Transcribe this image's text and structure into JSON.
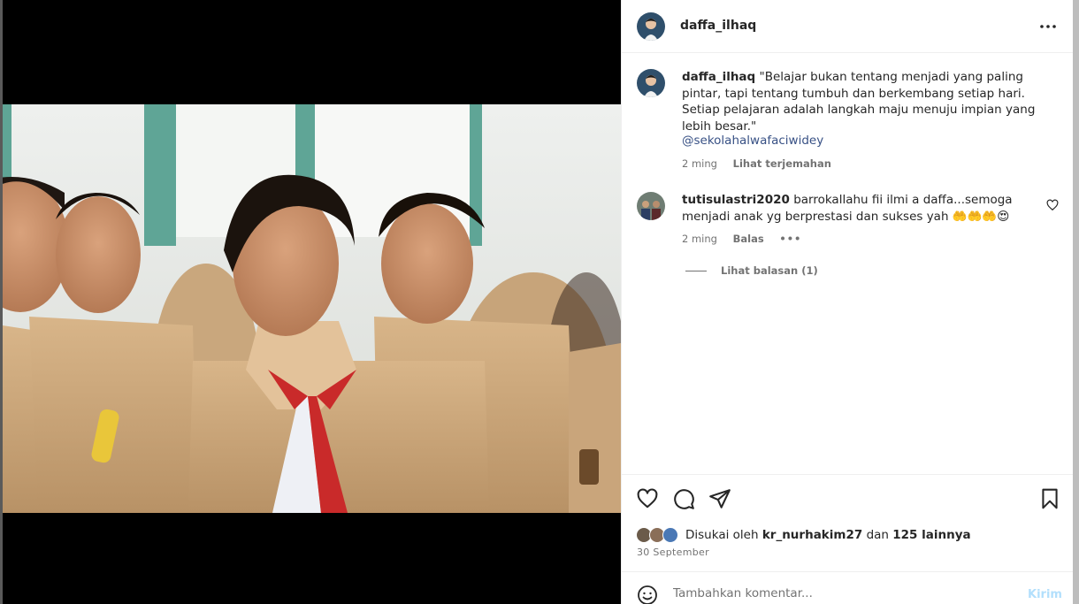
{
  "post": {
    "author": "daffa_ilhaq",
    "caption": "\"Belajar bukan tentang menjadi yang paling pintar, tapi tentang tumbuh dan berkembang setiap hari. Setiap pelajaran adalah langkah maju menuju impian yang lebih besar.\"",
    "mention": "@sekolahalwafaciwidey",
    "time": "2 ming",
    "translate_label": "Lihat terjemahan"
  },
  "comment": {
    "author": "tutisulastri2020",
    "text": "barrokallahu fii ilmi a daffa...semoga menjadi anak yg berprestasi dan sukses yah",
    "emojis": "🤲🤲🤲😍",
    "time": "2 ming",
    "reply_label": "Balas",
    "more_label": "•••",
    "view_replies_label": "Lihat balasan (1)"
  },
  "likes": {
    "prefix": "Disukai oleh",
    "user": "kr_nurhakim27",
    "and": "dan",
    "others": "125 lainnya"
  },
  "date": "30 September",
  "add_comment": {
    "placeholder": "Tambahkan komentar...",
    "post_label": "Kirim"
  },
  "icons": {
    "more": "more-horizontal-icon",
    "like": "heart-icon",
    "comment": "comment-bubble-icon",
    "share": "paper-plane-icon",
    "save": "bookmark-icon",
    "emoji": "smiley-icon"
  },
  "colors": {
    "link": "#385185",
    "muted": "#737373",
    "post_button": "#b2dffc"
  }
}
